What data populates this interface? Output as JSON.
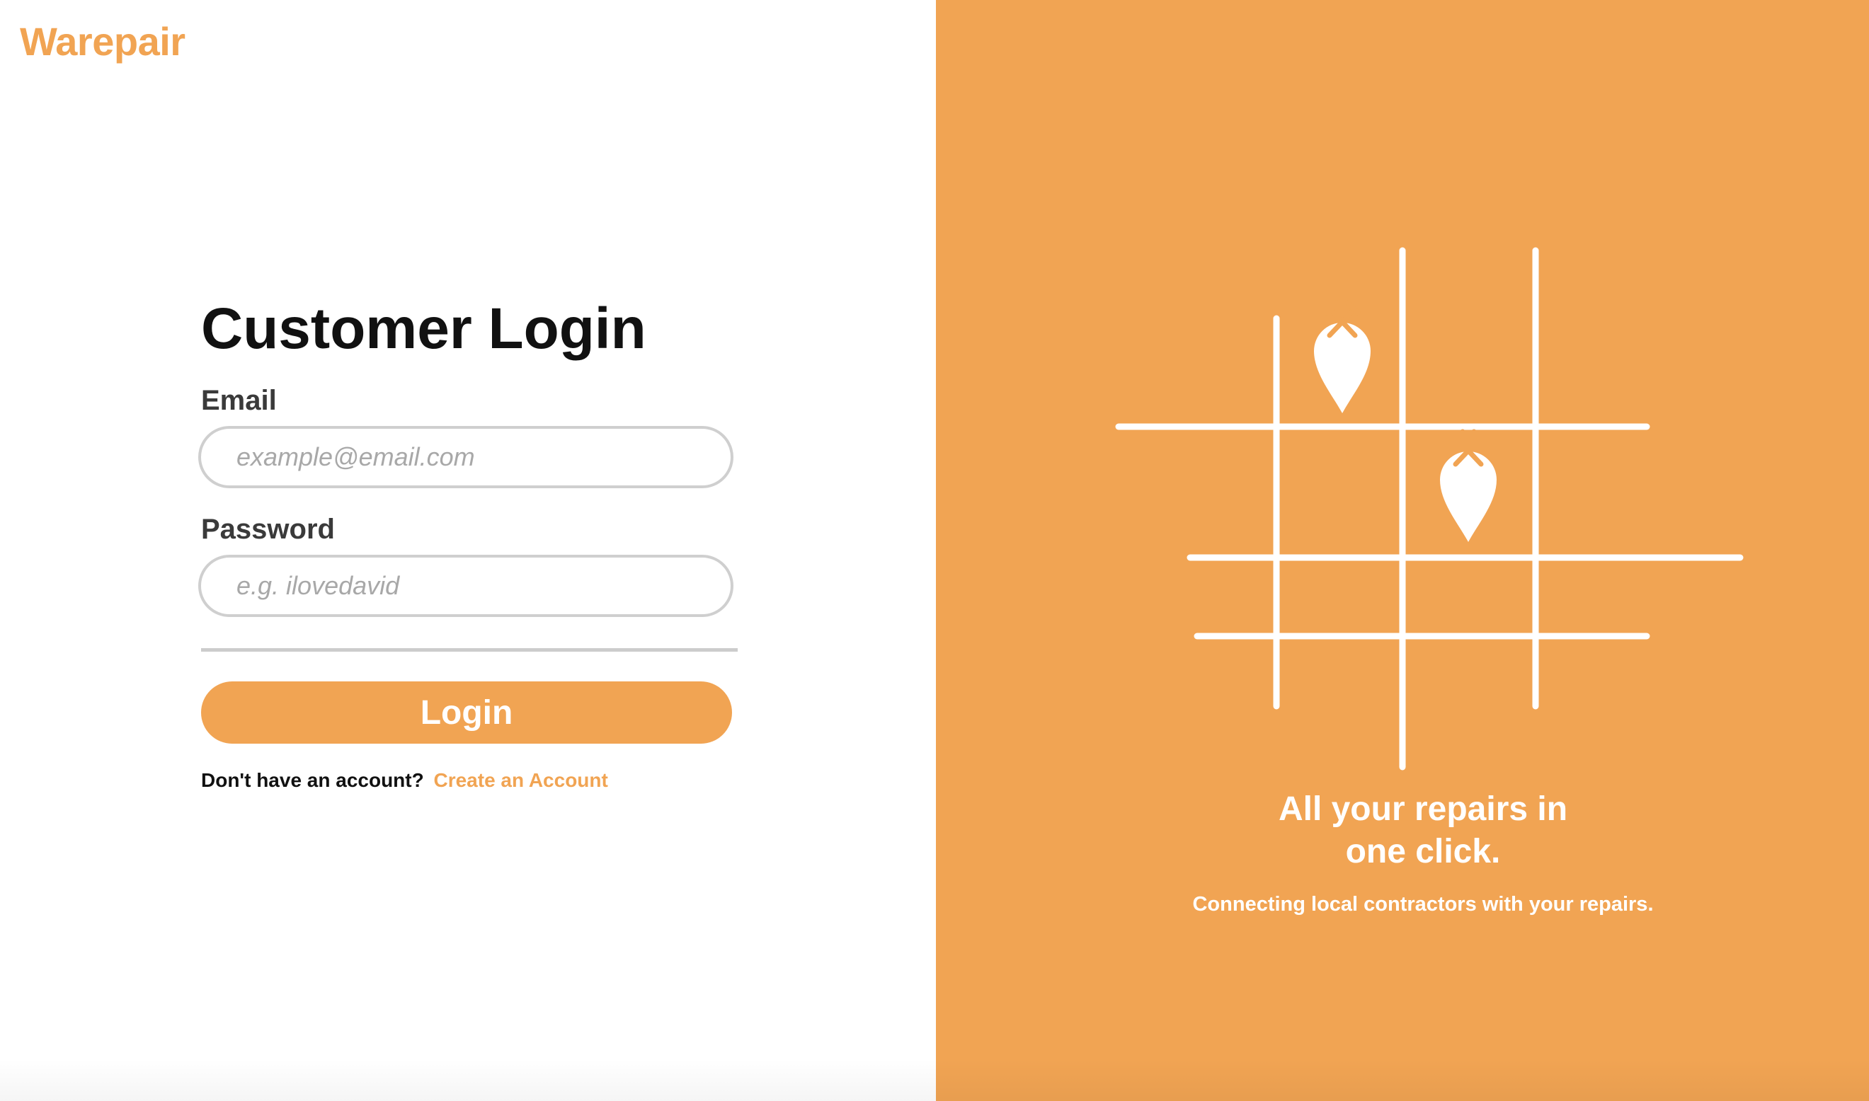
{
  "brand": {
    "name": "Warepair",
    "accent_color": "#f1a453"
  },
  "login_form": {
    "title": "Customer Login",
    "email_label": "Email",
    "email_placeholder": "example@email.com",
    "email_value": "",
    "password_label": "Password",
    "password_placeholder": "e.g. ilovedavid",
    "password_value": "",
    "submit_label": "Login"
  },
  "signup": {
    "prompt": "Don't have an account?",
    "link_label": "Create an Account"
  },
  "hero": {
    "background_color": "#f1a453",
    "tagline_line1": "All your repairs in",
    "tagline_line2": "one click.",
    "subtagline": "Connecting local contractors with your repairs.",
    "pin_icon": "map-pin-hammer-icon"
  }
}
